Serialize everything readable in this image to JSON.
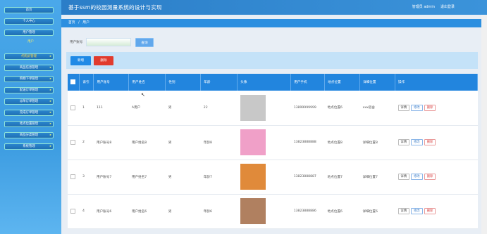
{
  "header": {
    "title": "基于ssm的校园测量系统的设计与实现",
    "user": "管理员 admin",
    "logout": "退出登录"
  },
  "sidebar": {
    "top_items": [
      {
        "label": "首页"
      },
      {
        "label": "个人中心"
      },
      {
        "label": "用户管理"
      }
    ],
    "section_caption": "用户",
    "items": [
      {
        "label": "代购员管理"
      },
      {
        "label": "商品信息管理"
      },
      {
        "label": "购物下单管理"
      },
      {
        "label": "配送订单管理"
      },
      {
        "label": "派单订单管理"
      },
      {
        "label": "完成订单管理"
      },
      {
        "label": "地点位置管理"
      },
      {
        "label": "商品分类管理"
      },
      {
        "label": "系统管理"
      }
    ]
  },
  "breadcrumb": {
    "home": "首页",
    "sep": "/",
    "current": "用户"
  },
  "search": {
    "label": "用户账号",
    "value": "",
    "button": "查询"
  },
  "actions": {
    "add": "新增",
    "delete": "删除"
  },
  "table": {
    "columns": [
      "",
      "索引",
      "用户账号",
      "用户姓名",
      "性别",
      "年龄",
      "头像",
      "用户手机",
      "地点位置",
      "详细位置",
      "操作"
    ],
    "rows": [
      {
        "index": "1",
        "account": "111",
        "name": "A用户",
        "gender": "男",
        "age": "22",
        "phone": "13899999999",
        "location": "地点位置6",
        "detail": "xxx宿舍",
        "avatar_color": "#c8c8c8"
      },
      {
        "index": "2",
        "account": "用户账号8",
        "name": "用户姓名8",
        "gender": "男",
        "age": "年龄8",
        "phone": "13823888888",
        "location": "地点位置8",
        "detail": "详细位置8",
        "avatar_color": "#f0a0c8"
      },
      {
        "index": "3",
        "account": "用户账号7",
        "name": "用户姓名7",
        "gender": "男",
        "age": "年龄7",
        "phone": "13823888887",
        "location": "地点位置7",
        "detail": "详细位置7",
        "avatar_color": "#e08a3a"
      },
      {
        "index": "4",
        "account": "用户账号6",
        "name": "用户姓名6",
        "gender": "男",
        "age": "年龄6",
        "phone": "13823888886",
        "location": "地点位置6",
        "detail": "详细位置6",
        "avatar_color": "#b08060"
      }
    ],
    "ops": {
      "detail": "详情",
      "edit": "修改",
      "delete": "删除"
    }
  },
  "colors": {
    "accent": "#2285de",
    "danger": "#e13b2d"
  }
}
